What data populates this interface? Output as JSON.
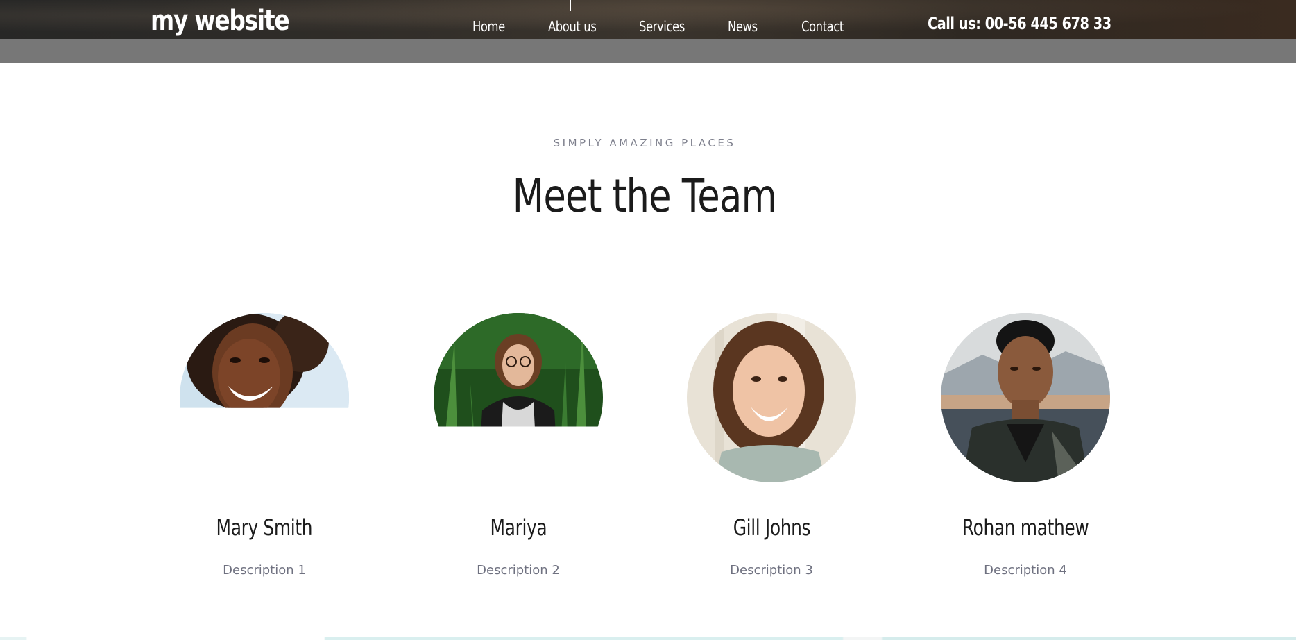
{
  "header": {
    "logo": "my website",
    "nav": [
      {
        "label": "Home"
      },
      {
        "label": "About us"
      },
      {
        "label": "Services"
      },
      {
        "label": "News"
      },
      {
        "label": "Contact"
      }
    ],
    "phone": "Call us: 00-56 445 678 33"
  },
  "section": {
    "eyebrow": "SIMPLY AMAZING PLACES",
    "title": "Meet the Team"
  },
  "team": [
    {
      "name": "Mary Smith",
      "description": "Description 1",
      "photo_reveal": 0.56
    },
    {
      "name": "Mariya",
      "description": "Description 2",
      "photo_reveal": 0.67
    },
    {
      "name": "Gill Johns",
      "description": "Description 3",
      "photo_reveal": 1.0
    },
    {
      "name": "Rohan mathew",
      "description": "Description 4",
      "photo_reveal": 1.0
    }
  ],
  "colors": {
    "header_bg": "#2f2c28",
    "subbar_bg": "#777777",
    "heading_text": "#1b1b1b",
    "muted_text": "#7d7f8c"
  }
}
